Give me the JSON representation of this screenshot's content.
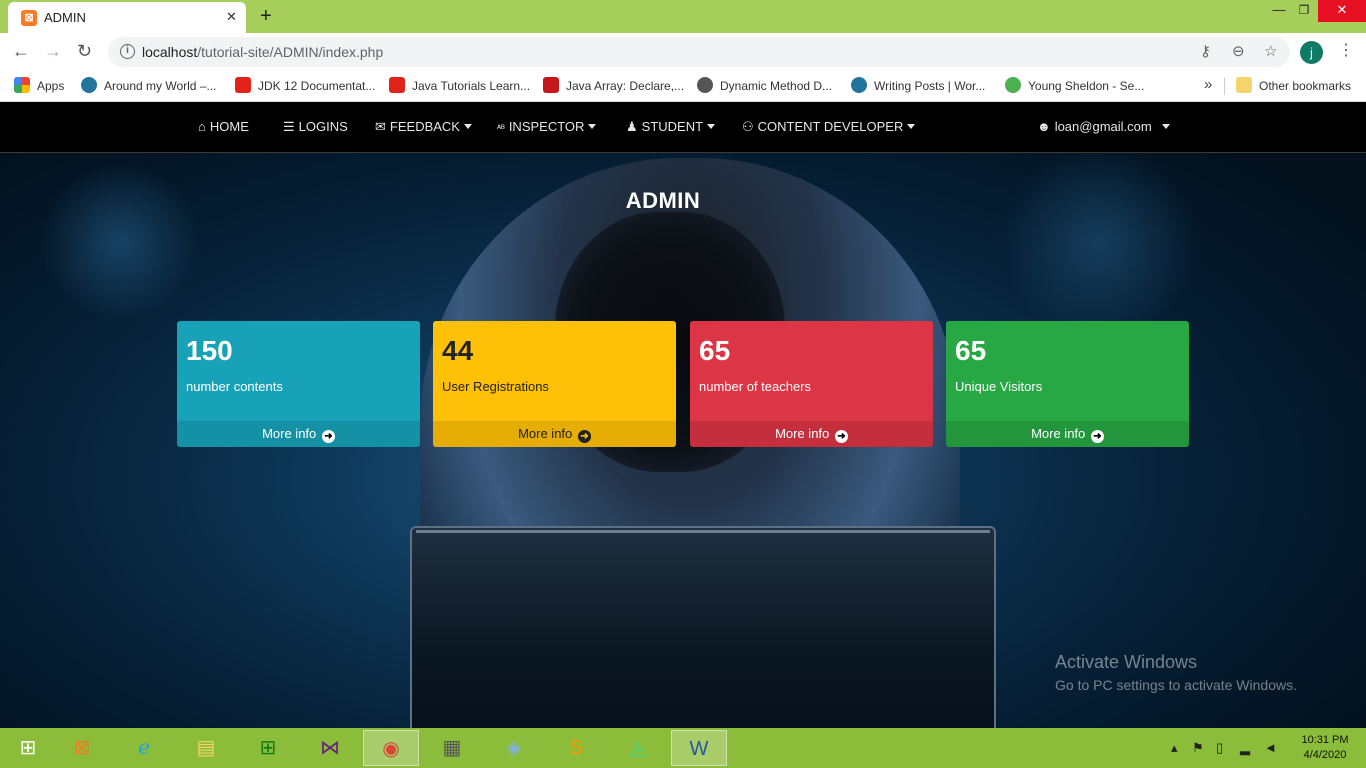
{
  "browser": {
    "tab_title": "ADMIN",
    "tab_close": "✕",
    "new_tab": "+",
    "window_controls": {
      "minimize": "—",
      "maximize": "❐",
      "close": "✕"
    },
    "url_host": "localhost",
    "url_path": "/tutorial-site/ADMIN/index.php",
    "profile_initial": "j",
    "bookmarks": [
      {
        "label": "Apps",
        "icon": "apps-grid-icon",
        "color": "#4285f4"
      },
      {
        "label": "Around my World –...",
        "icon": "wordpress-icon",
        "color": "#21759b"
      },
      {
        "label": "JDK 12 Documentat...",
        "icon": "oracle-icon",
        "color": "#e2231a"
      },
      {
        "label": "Java Tutorials Learn...",
        "icon": "oracle-icon",
        "color": "#e2231a"
      },
      {
        "label": "Java Array: Declare,...",
        "icon": "site-icon",
        "color": "#c4161c"
      },
      {
        "label": "Dynamic Method D...",
        "icon": "globe-icon",
        "color": "#555555"
      },
      {
        "label": "Writing Posts | Wor...",
        "icon": "wordpress-icon",
        "color": "#21759b"
      },
      {
        "label": "Young Sheldon - Se...",
        "icon": "play-icon",
        "color": "#4caf50"
      }
    ],
    "other_bookmarks": "Other bookmarks"
  },
  "navbar": {
    "items": [
      {
        "label": "HOME",
        "icon": "home-icon",
        "glyph": "⌂",
        "dropdown": false
      },
      {
        "label": "LOGINS",
        "icon": "server-icon",
        "glyph": "☰",
        "dropdown": false
      },
      {
        "label": "FEEDBACK",
        "icon": "feedback-icon",
        "glyph": "✉",
        "dropdown": true
      },
      {
        "label": "INSPECTOR",
        "icon": "spellcheck-icon",
        "glyph": "ᴬᴮ",
        "dropdown": true
      },
      {
        "label": "STUDENT",
        "icon": "user-graduate-icon",
        "glyph": "♟",
        "dropdown": true
      },
      {
        "label": "CONTENT DEVELOPER",
        "icon": "chalkboard-icon",
        "glyph": "⚇",
        "dropdown": true
      }
    ],
    "user_email": "loan@gmail.com",
    "user_icon": "users-icon"
  },
  "page": {
    "title": "ADMIN"
  },
  "cards": [
    {
      "value": "150",
      "label": "number contents",
      "footer": "More info",
      "color": "#17a2b8"
    },
    {
      "value": "44",
      "label": "User Registrations",
      "footer": "More info",
      "color": "#ffc107"
    },
    {
      "value": "65",
      "label": "number of teachers",
      "footer": "More info",
      "color": "#dc3545"
    },
    {
      "value": "65",
      "label": "Unique Visitors",
      "footer": "More info",
      "color": "#28a745"
    }
  ],
  "watermark": {
    "line1": "Activate Windows",
    "line2": "Go to PC settings to activate Windows."
  },
  "taskbar": {
    "time": "10:31 PM",
    "date": "4/4/2020"
  }
}
